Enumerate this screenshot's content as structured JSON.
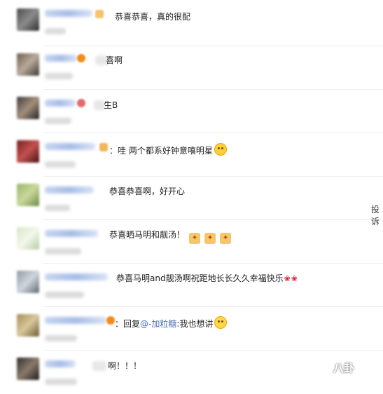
{
  "comments": [
    {
      "text": "恭喜恭喜，真的很配"
    },
    {
      "text": "喜啊"
    },
    {
      "text": "生B"
    },
    {
      "text": "哇 两个都系好钟意嘻明星"
    },
    {
      "text": "恭喜恭喜啊，好开心"
    },
    {
      "text": "恭喜晒马明和靓汤！"
    },
    {
      "text": "恭喜马明and靓汤啊祝距地长长久久幸福快乐"
    },
    {
      "reply_prefix": "回复",
      "mention": "@-加粒糖",
      "text": ":我也想讲"
    },
    {
      "text": "啊！！！"
    }
  ],
  "row4_prefix": "：",
  "row8_prefix": "：",
  "edge_label": "投诉",
  "watermark": "八卦",
  "icons": {
    "emoji_surprised": "flushed-face-icon",
    "emoji_laugh": "laughing-face-icon",
    "celebrate": "celebration-sticker-icon",
    "rose": "rose-icon"
  },
  "colors": {
    "mention": "#4a6fb5",
    "name_blur": "#a7bde6",
    "divider": "#ececec"
  }
}
